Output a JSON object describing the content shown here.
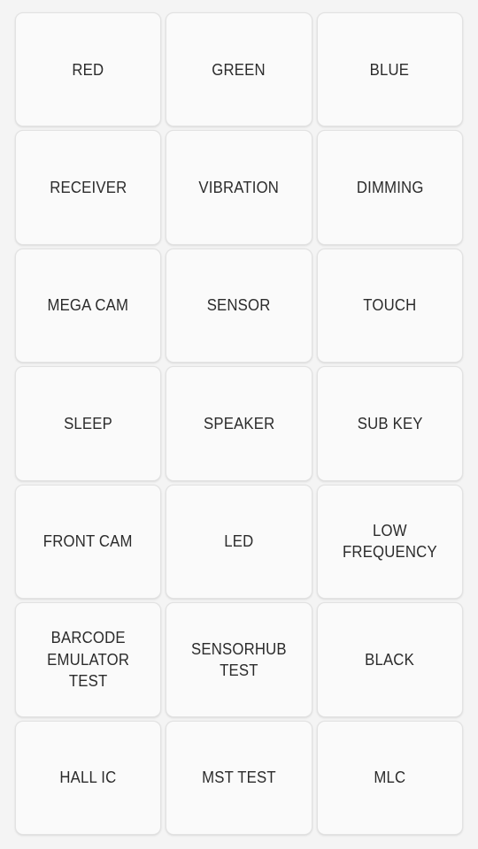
{
  "screen": {
    "name": "factory-test-menu",
    "background_color": "#f4f4f4",
    "card_color": "#fafafa",
    "card_border_color": "#e2e2e2",
    "text_color": "#2b2b2b",
    "columns": 3,
    "rows": 7
  },
  "grid": {
    "items": [
      {
        "label": "RED"
      },
      {
        "label": "GREEN"
      },
      {
        "label": "BLUE"
      },
      {
        "label": "RECEIVER"
      },
      {
        "label": "VIBRATION"
      },
      {
        "label": "DIMMING"
      },
      {
        "label": "MEGA CAM"
      },
      {
        "label": "SENSOR"
      },
      {
        "label": "TOUCH"
      },
      {
        "label": "SLEEP"
      },
      {
        "label": "SPEAKER"
      },
      {
        "label": "SUB KEY"
      },
      {
        "label": "FRONT CAM"
      },
      {
        "label": "LED"
      },
      {
        "label": "LOW\nFREQUENCY"
      },
      {
        "label": "BARCODE\nEMULATOR TEST"
      },
      {
        "label": "SENSORHUB\nTEST"
      },
      {
        "label": "BLACK"
      },
      {
        "label": "HALL IC"
      },
      {
        "label": "MST TEST"
      },
      {
        "label": "MLC"
      }
    ]
  }
}
